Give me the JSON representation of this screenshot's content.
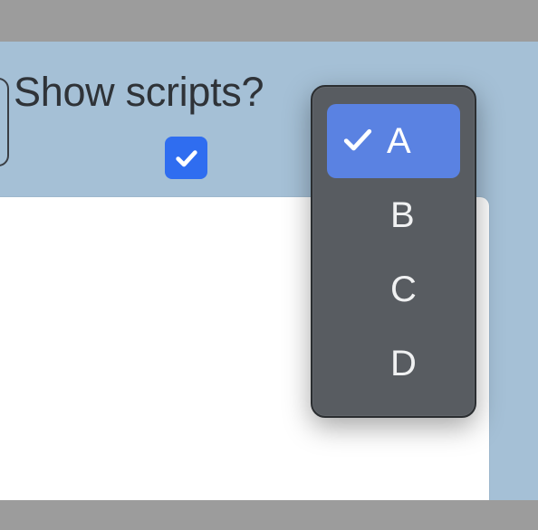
{
  "panel": {
    "show_scripts_label": "Show scripts?",
    "show_scripts_checked": true
  },
  "dropdown": {
    "options": [
      {
        "label": "A",
        "selected": true
      },
      {
        "label": "B",
        "selected": false
      },
      {
        "label": "C",
        "selected": false
      },
      {
        "label": "D",
        "selected": false
      }
    ]
  },
  "icons": {
    "checkbox_check": "check-icon",
    "selected_option": "checkmark-icon"
  },
  "colors": {
    "panel_background": "#a5c0d6",
    "checkbox_fill": "#2f6df0",
    "menu_background": "#585c61",
    "menu_selected": "#5a82e2",
    "bars": "#9c9c9c"
  }
}
